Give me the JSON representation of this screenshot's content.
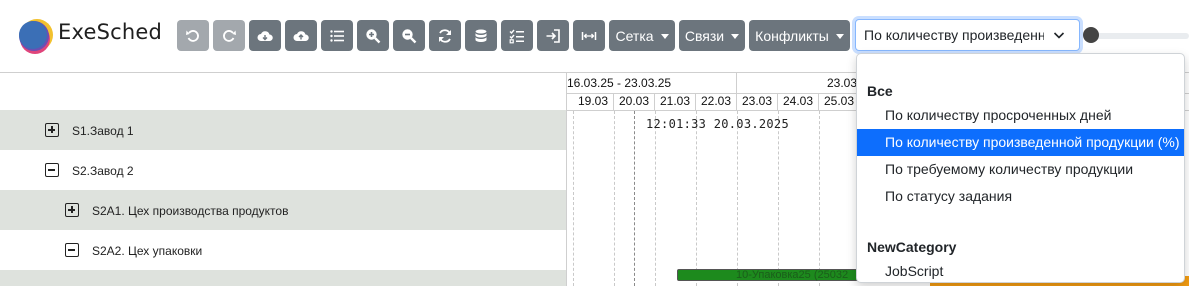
{
  "app": {
    "name": "ExeSched",
    "brand_colors": [
      "#3b6fb6",
      "#f2c12e",
      "#e0457b",
      "#6a4fb3"
    ]
  },
  "toolbar": {
    "icon_buttons": [
      {
        "icon": "undo-icon",
        "enabled": false
      },
      {
        "icon": "redo-icon",
        "enabled": false
      },
      {
        "icon": "cloud-download-icon",
        "enabled": true
      },
      {
        "icon": "cloud-upload-icon",
        "enabled": true
      },
      {
        "icon": "list-icon",
        "enabled": true
      },
      {
        "icon": "zoom-in-icon",
        "enabled": true
      },
      {
        "icon": "zoom-out-icon",
        "enabled": true
      },
      {
        "icon": "refresh-icon",
        "enabled": true
      },
      {
        "icon": "database-icon",
        "enabled": true
      },
      {
        "icon": "checklist-icon",
        "enabled": true
      },
      {
        "icon": "sign-in-icon",
        "enabled": true
      },
      {
        "icon": "fit-width-icon",
        "enabled": true
      }
    ],
    "grid_label": "Сетка",
    "links_label": "Связи",
    "conflicts_label": "Конфликты",
    "sort_select_value": "По количеству произведенной продукции (%)"
  },
  "tree": {
    "rows": [
      {
        "label": "S1.Завод 1",
        "expanded": false
      },
      {
        "label": "S2.Завод 2",
        "expanded": true
      },
      {
        "label": "S2A1. Цех производства продуктов",
        "expanded": false
      },
      {
        "label": "S2A2. Цех упаковки",
        "expanded": true
      }
    ]
  },
  "timeline": {
    "weeks": [
      "16.03.25 - 23.03.25",
      "23.03"
    ],
    "days": [
      "19.03",
      "20.03",
      "21.03",
      "22.03",
      "23.03",
      "24.03",
      "25.03"
    ],
    "current_time": "12:01:33  20.03.2025",
    "task_bar_label": "10-Упаковка25 (25032",
    "task_bar_color": "#1d8a1d"
  },
  "sort_menu": {
    "group_all": "Все",
    "items": [
      "По количеству просроченных дней",
      "По количеству произведенной продукции (%)",
      "По требуемому количеству продукции",
      "По статусу задания"
    ],
    "active_index": 1,
    "group_new": "NewCategory",
    "new_items": [
      "JobScript"
    ]
  }
}
